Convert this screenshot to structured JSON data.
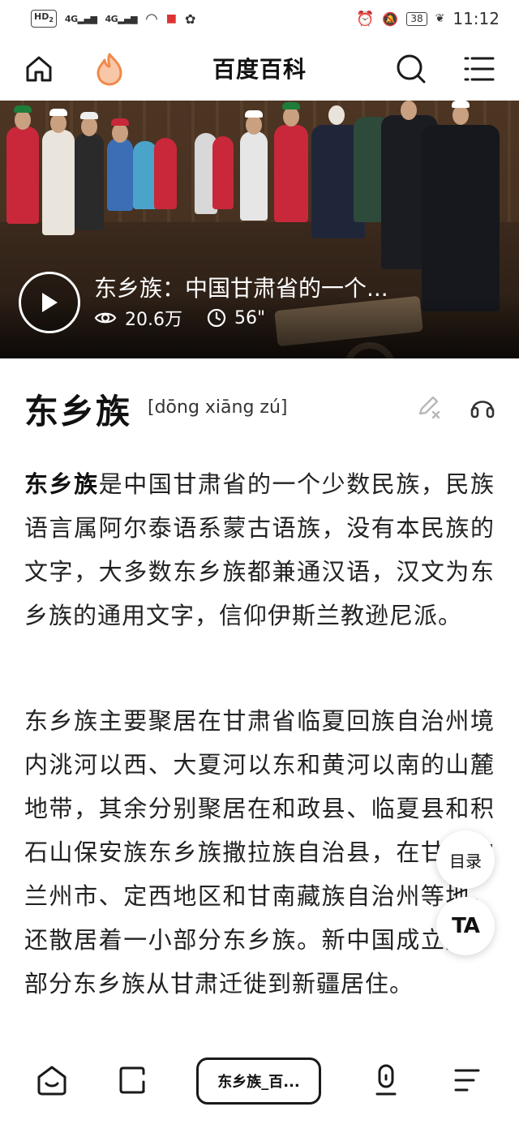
{
  "status_bar": {
    "hd": "HD",
    "hd_sub": "2",
    "signal1": "4G",
    "signal2": "4G",
    "battery": "38",
    "time": "11:12"
  },
  "header": {
    "title": "百度百科",
    "icons": [
      "home-icon",
      "hot-flame-icon",
      "search-icon",
      "menu-icon"
    ],
    "accent": "#f08a4b"
  },
  "video": {
    "title": "东乡族：中国甘肃省的一个...",
    "views": "20.6万",
    "duration": "56\""
  },
  "entry": {
    "title": "东乡族",
    "pinyin": "[dōng xiāng zú]"
  },
  "paragraphs": {
    "p1_bold": "东乡族",
    "p1_rest": "是中国甘肃省的一个少数民族，民族语言属阿尔泰语系蒙古语族，没有本民族的文字，大多数东乡族都兼通汉语，汉文为东乡族的通用文字，信仰伊斯兰教逊尼派。",
    "p2": "东乡族主要聚居在甘肃省临夏回族自治州境内洮河以西、大夏河以东和黄河以南的山麓地带，其余分别聚居在和政县、临夏县和积石山保安族东乡族撒拉族自治县，在甘肃的兰州市、定西地区和甘南藏族自治州等地，还散居着一小部分东乡族。新中国成立后，部分东乡族从甘肃迁徙到新疆居住。"
  },
  "floating": {
    "toc": "目录",
    "ta": "TA"
  },
  "bottom_nav": {
    "tab_label": "东乡族_百..."
  }
}
